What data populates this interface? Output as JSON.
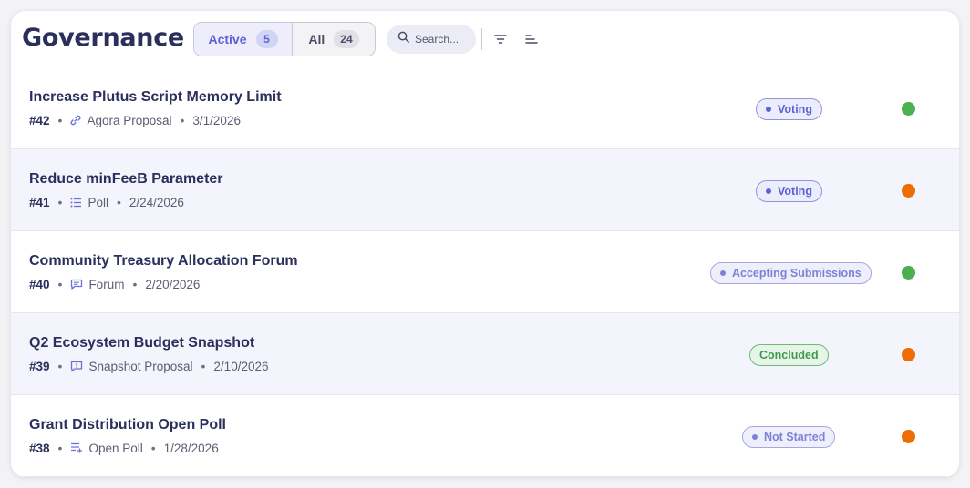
{
  "header": {
    "title": "Governance",
    "tabs": {
      "active_label": "Active",
      "active_count": "5",
      "all_label": "All",
      "all_count": "24"
    },
    "search": {
      "placeholder": "Search..."
    },
    "icons": [
      "search-icon",
      "filter-icon",
      "sort-icon"
    ]
  },
  "colors": {
    "accent": "#5b62d6",
    "green": "#4caf50",
    "orange": "#ef6c00",
    "title": "#2b2f5c"
  },
  "proposals": [
    {
      "title": "Increase Plutus Script Memory Limit",
      "number": "#42",
      "type_icon": "link-icon",
      "type": "Agora Proposal",
      "date": "3/1/2026",
      "status": "Voting",
      "indicator_color": "#4caf50"
    },
    {
      "title": "Reduce minFeeB Parameter",
      "number": "#41",
      "type_icon": "list-icon",
      "type": "Poll",
      "date": "2/24/2026",
      "status": "Voting",
      "indicator_color": "#ef6c00"
    },
    {
      "title": "Community Treasury Allocation Forum",
      "number": "#40",
      "type_icon": "comment-icon",
      "type": "Forum",
      "date": "2/20/2026",
      "status": "Accepting Submissions",
      "indicator_color": "#4caf50"
    },
    {
      "title": "Q2 Ecosystem Budget Snapshot",
      "number": "#39",
      "type_icon": "message-square-icon",
      "type": "Snapshot Proposal",
      "date": "2/10/2026",
      "status": "Concluded",
      "indicator_color": "#ef6c00"
    },
    {
      "title": "Grant Distribution Open Poll",
      "number": "#38",
      "type_icon": "playlist-add-icon",
      "type": "Open Poll",
      "date": "1/28/2026",
      "status": "Not Started",
      "indicator_color": "#ef6c00"
    }
  ]
}
